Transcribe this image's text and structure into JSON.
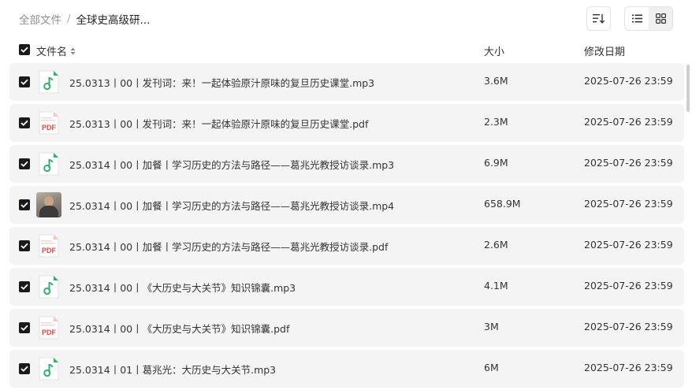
{
  "breadcrumb": {
    "root": "全部文件",
    "separator": "/",
    "current": "全球史高级研..."
  },
  "toolbar": {
    "sort_icon": "sort-icon",
    "list_view_icon": "list-view-icon",
    "grid_view_icon": "grid-view-icon",
    "active_view": "list"
  },
  "columns": {
    "name": "文件名",
    "size": "大小",
    "date": "修改日期"
  },
  "colors": {
    "audio_icon": "#2fb36b",
    "pdf_icon": "#e8473d",
    "row_bg": "#f4f4f5",
    "checkbox": "#1a1a1a"
  },
  "files": [
    {
      "type": "audio",
      "icon": "music-note-icon",
      "name": "25.0313丨00丨发刊词：来！一起体验原汁原味的复旦历史课堂.mp3",
      "size": "3.6M",
      "date": "2025-07-26 23:59",
      "checked": true
    },
    {
      "type": "pdf",
      "icon": "pdf-file-icon",
      "name": "25.0313丨00丨发刊词：来！一起体验原汁原味的复旦历史课堂.pdf",
      "size": "2.3M",
      "date": "2025-07-26 23:59",
      "checked": true
    },
    {
      "type": "audio",
      "icon": "music-note-icon",
      "name": "25.0314丨00丨加餐丨学习历史的方法与路径——葛兆光教授访谈录.mp3",
      "size": "6.9M",
      "date": "2025-07-26 23:59",
      "checked": true
    },
    {
      "type": "video",
      "icon": "video-thumbnail",
      "name": "25.0314丨00丨加餐丨学习历史的方法与路径——葛兆光教授访谈录.mp4",
      "size": "658.9M",
      "date": "2025-07-26 23:59",
      "checked": true
    },
    {
      "type": "pdf",
      "icon": "pdf-file-icon",
      "name": "25.0314丨00丨加餐丨学习历史的方法与路径——葛兆光教授访谈录.pdf",
      "size": "2.6M",
      "date": "2025-07-26 23:59",
      "checked": true
    },
    {
      "type": "audio",
      "icon": "music-note-icon",
      "name": "25.0314丨00丨《大历史与大关节》知识锦囊.mp3",
      "size": "4.1M",
      "date": "2025-07-26 23:59",
      "checked": true
    },
    {
      "type": "pdf",
      "icon": "pdf-file-icon",
      "name": "25.0314丨00丨《大历史与大关节》知识锦囊.pdf",
      "size": "3M",
      "date": "2025-07-26 23:59",
      "checked": true
    },
    {
      "type": "audio",
      "icon": "music-note-icon",
      "name": "25.0314丨01丨葛兆光：大历史与大关节.mp3",
      "size": "6M",
      "date": "2025-07-26 23:59",
      "checked": true
    }
  ]
}
